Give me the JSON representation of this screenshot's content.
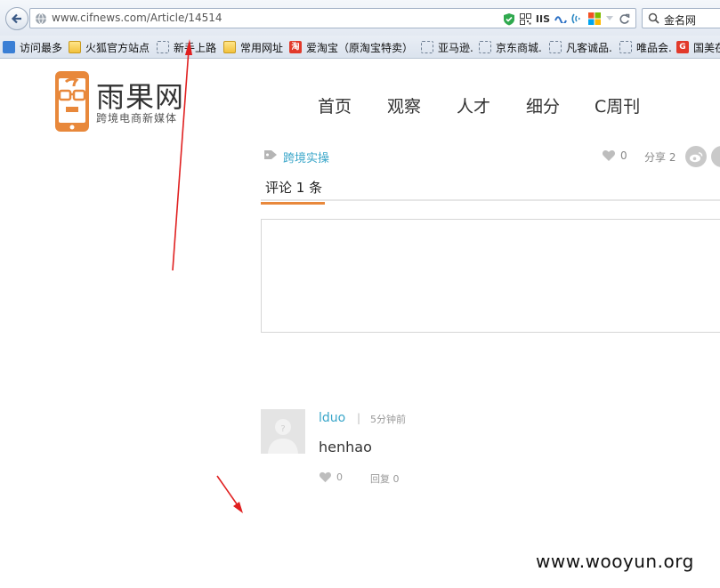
{
  "browser": {
    "url": "www.cifnews.com/Article/14514",
    "url_badge": "IIS",
    "search_text": "金名网",
    "bookmarks": [
      {
        "label": "访问最多",
        "icon": "blue"
      },
      {
        "label": "火狐官方站点",
        "icon": "folder"
      },
      {
        "label": "新手上路",
        "icon": "dashed"
      },
      {
        "label": "常用网址",
        "icon": "folder"
      },
      {
        "label": "爱淘宝（原淘宝特卖）",
        "icon": "red"
      },
      {
        "label": "亚马逊.",
        "icon": "dashed"
      },
      {
        "label": "京东商城.",
        "icon": "dashed"
      },
      {
        "label": "凡客诚品.",
        "icon": "dashed"
      },
      {
        "label": "唯品会.",
        "icon": "dashed"
      },
      {
        "label": "国美在",
        "icon": "red"
      }
    ]
  },
  "site": {
    "logo_title": "雨果网",
    "logo_slogan": "跨境电商新媒体",
    "nav": [
      "首页",
      "观察",
      "人才",
      "细分",
      "C周刊"
    ],
    "brand_color": "#e8883b",
    "link_color": "#3aa6c9"
  },
  "article": {
    "tag": "跨境实操",
    "likes": "0",
    "share_label": "分享",
    "share_count": "2"
  },
  "comments": {
    "heading": "评论 1 条",
    "items": [
      {
        "user": "lduo",
        "separator": "|",
        "time": "5分钟前",
        "text": "henhao",
        "likes": "0",
        "reply_label": "回复 0"
      }
    ]
  },
  "watermark": "www.wooyun.org",
  "annotation_color": "#e02020"
}
